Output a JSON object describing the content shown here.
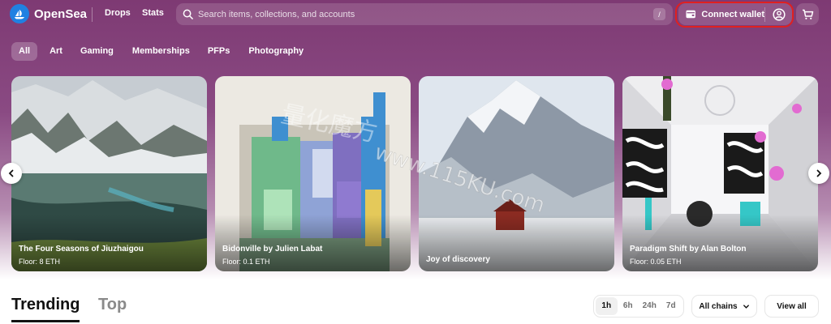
{
  "header": {
    "brand": "OpenSea",
    "nav": [
      "Drops",
      "Stats"
    ],
    "search_placeholder": "Search items, collections, and accounts",
    "search_shortcut": "/",
    "connect_wallet": "Connect wallet"
  },
  "categories": {
    "items": [
      "All",
      "Art",
      "Gaming",
      "Memberships",
      "PFPs",
      "Photography"
    ],
    "selected": "All"
  },
  "carousel": {
    "cards": [
      {
        "title": "The Four Seasons of Jiuzhaigou",
        "floor": "Floor: 8 ETH"
      },
      {
        "title": "Bidonville by Julien Labat",
        "floor": "Floor: 0.1 ETH"
      },
      {
        "title": "Joy of discovery",
        "floor": ""
      },
      {
        "title": "Paradigm Shift by Alan Bolton",
        "floor": "Floor: 0.05 ETH"
      }
    ]
  },
  "section": {
    "tabs": [
      "Trending",
      "Top"
    ],
    "active_tab": "Trending",
    "time_ranges": [
      "1h",
      "6h",
      "24h",
      "7d"
    ],
    "active_range": "1h",
    "chains_label": "All chains",
    "view_all": "View all"
  },
  "watermark": {
    "line1": "量化魔方",
    "line2": "www.115KU.com"
  },
  "colors": {
    "hero_top": "#7e3a73",
    "brand_blue": "#2081e2",
    "highlight": "#e02020"
  },
  "icons": [
    "opensea-logo-icon",
    "search-icon",
    "wallet-icon",
    "profile-icon",
    "cart-icon",
    "chevron-left-icon",
    "chevron-right-icon",
    "chevron-down-icon"
  ]
}
